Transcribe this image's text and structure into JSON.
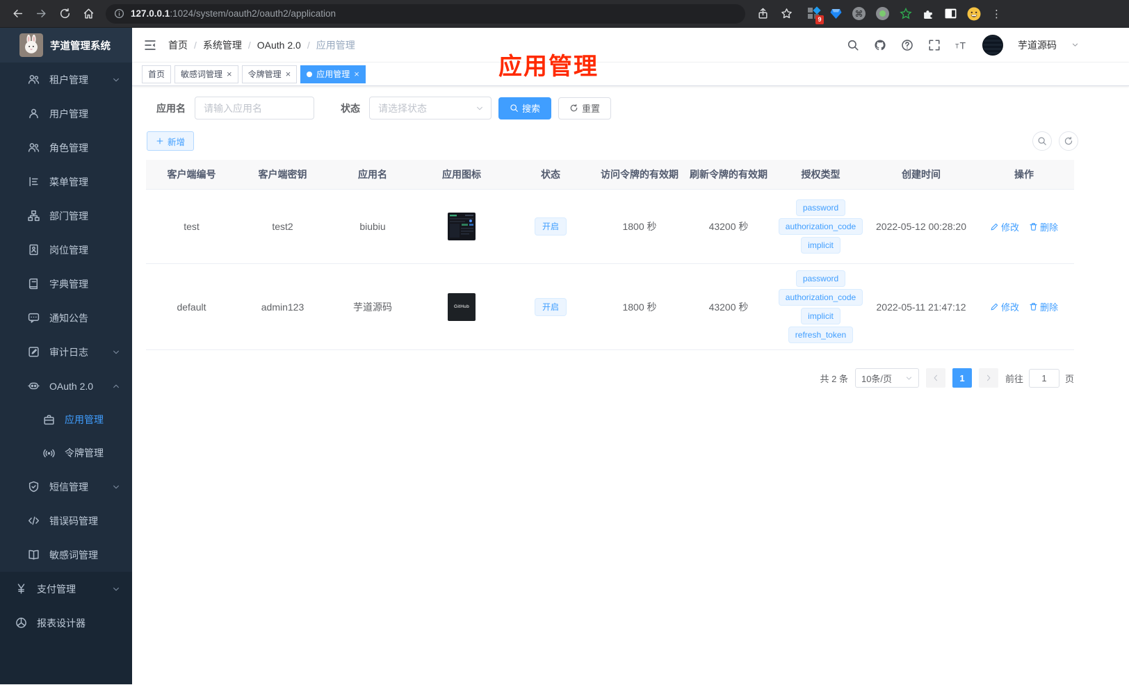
{
  "browser": {
    "url_host": "127.0.0.1",
    "url_rest": ":1024/system/oauth2/oauth2/application",
    "extension_badge": "9"
  },
  "colors": {
    "accent": "#409eff",
    "tag_bg": "#ecf5ff",
    "tag_border": "#d9ecff",
    "overlay_red": "#ff2a00",
    "sidebar_bg": "#1f2d3d",
    "active_tab_bg": "#409eff"
  },
  "sidebar": {
    "app_title": "芋道管理系统",
    "items": [
      {
        "slug": "tenant",
        "label": "租户管理",
        "icon": "users-icon",
        "chevron": "down",
        "level": 1
      },
      {
        "slug": "user",
        "label": "用户管理",
        "icon": "user-icon",
        "chevron": "",
        "level": 1
      },
      {
        "slug": "role",
        "label": "角色管理",
        "icon": "users-icon",
        "chevron": "",
        "level": 1
      },
      {
        "slug": "menu",
        "label": "菜单管理",
        "icon": "menu-tree-icon",
        "chevron": "",
        "level": 1
      },
      {
        "slug": "dept",
        "label": "部门管理",
        "icon": "org-chart-icon",
        "chevron": "",
        "level": 1
      },
      {
        "slug": "post",
        "label": "岗位管理",
        "icon": "id-badge-icon",
        "chevron": "",
        "level": 1
      },
      {
        "slug": "dict",
        "label": "字典管理",
        "icon": "dictionary-icon",
        "chevron": "",
        "level": 1
      },
      {
        "slug": "notice",
        "label": "通知公告",
        "icon": "message-icon",
        "chevron": "",
        "level": 1
      },
      {
        "slug": "audit-log",
        "label": "审计日志",
        "icon": "log-icon",
        "chevron": "down",
        "level": 1
      },
      {
        "slug": "oauth2",
        "label": "OAuth 2.0",
        "icon": "robot-icon",
        "chevron": "up",
        "level": 1
      },
      {
        "slug": "oauth2-application",
        "label": "应用管理",
        "icon": "briefcase-icon",
        "chevron": "",
        "level": 2,
        "active": true
      },
      {
        "slug": "oauth2-token",
        "label": "令牌管理",
        "icon": "token-icon",
        "chevron": "",
        "level": 2
      },
      {
        "slug": "sms",
        "label": "短信管理",
        "icon": "shield-icon",
        "chevron": "down",
        "level": 1
      },
      {
        "slug": "error-code",
        "label": "错误码管理",
        "icon": "code-icon",
        "chevron": "",
        "level": 1
      },
      {
        "slug": "sensitive-word",
        "label": "敏感词管理",
        "icon": "open-book-icon",
        "chevron": "",
        "level": 1
      },
      {
        "slug": "pay",
        "label": "支付管理",
        "icon": "yen-icon",
        "chevron": "down",
        "level": 0
      },
      {
        "slug": "report-designer",
        "label": "报表设计器",
        "icon": "report-icon",
        "chevron": "",
        "level": 0
      }
    ]
  },
  "header": {
    "breadcrumb": [
      "首页",
      "系统管理",
      "OAuth 2.0",
      "应用管理"
    ],
    "user_name": "芋道源码"
  },
  "tabs": [
    {
      "slug": "home",
      "label": "首页",
      "closable": false,
      "active": false
    },
    {
      "slug": "sensitive-word",
      "label": "敏感词管理",
      "closable": true,
      "active": false
    },
    {
      "slug": "token",
      "label": "令牌管理",
      "closable": true,
      "active": false
    },
    {
      "slug": "application",
      "label": "应用管理",
      "closable": true,
      "active": true
    }
  ],
  "overlay_title": "应用管理",
  "filters": {
    "name_label": "应用名",
    "name_placeholder": "请输入应用名",
    "status_label": "状态",
    "status_placeholder": "请选择状态",
    "search_label": "搜索",
    "reset_label": "重置"
  },
  "toolbar": {
    "add_label": "新增"
  },
  "table": {
    "headers": [
      "客户端编号",
      "客户端密钥",
      "应用名",
      "应用图标",
      "状态",
      "访问令牌的有效期",
      "刷新令牌的有效期",
      "授权类型",
      "创建时间",
      "操作"
    ],
    "actions": {
      "edit": "修改",
      "delete": "删除"
    },
    "rows": [
      {
        "client_id": "test",
        "secret": "test2",
        "name": "biubiu",
        "icon": "app-screenshot-thumb",
        "icon_text": "",
        "status": "开启",
        "access_ttl": "1800 秒",
        "refresh_ttl": "43200 秒",
        "grant_types": [
          "password",
          "authorization_code",
          "implicit"
        ],
        "created_at": "2022-05-12 00:28:20"
      },
      {
        "client_id": "default",
        "secret": "admin123",
        "name": "芋道源码",
        "icon": "github-thumb",
        "icon_text": "GitHub",
        "status": "开启",
        "access_ttl": "1800 秒",
        "refresh_ttl": "43200 秒",
        "grant_types": [
          "password",
          "authorization_code",
          "implicit",
          "refresh_token"
        ],
        "created_at": "2022-05-11 21:47:12"
      }
    ]
  },
  "pagination": {
    "total": "共 2 条",
    "page_size": "10条/页",
    "current_page": "1",
    "goto_prefix": "前往",
    "goto_value": "1",
    "goto_suffix": "页"
  }
}
